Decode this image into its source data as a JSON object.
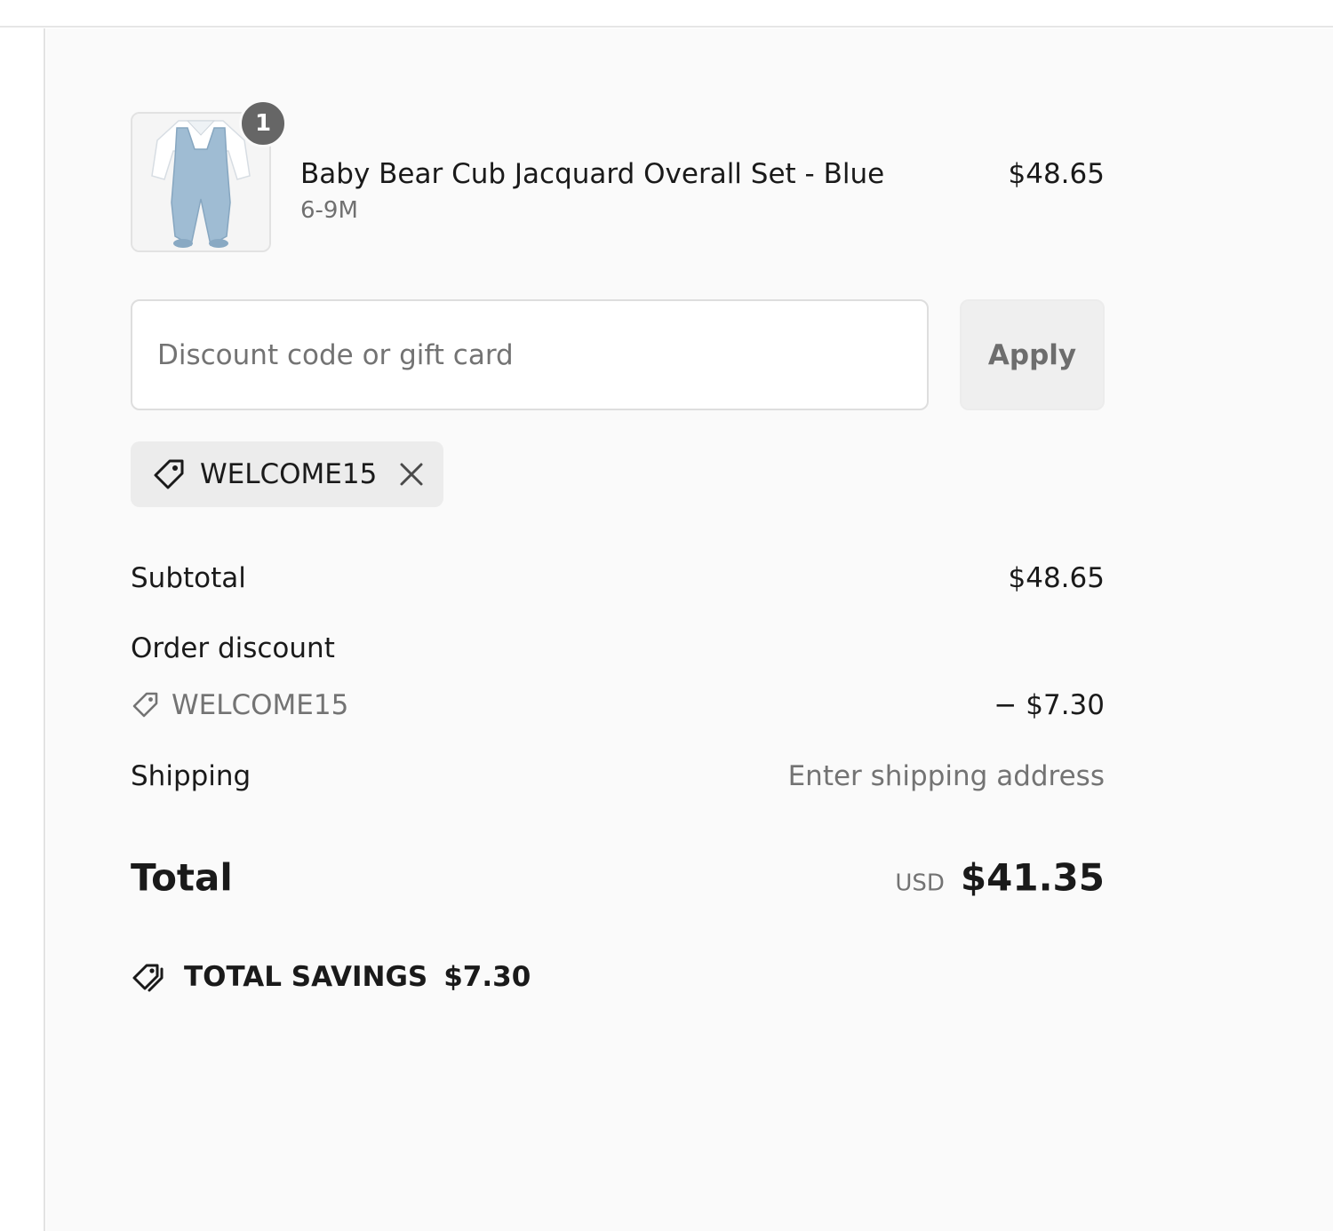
{
  "cart": {
    "items": [
      {
        "name": "Baby Bear Cub Jacquard Overall Set - Blue",
        "variant": "6-9M",
        "price": "$48.65",
        "quantity": "1",
        "image_icon": "overall-set-image"
      }
    ]
  },
  "discount": {
    "placeholder": "Discount code or gift card",
    "value": "",
    "apply_label": "Apply",
    "applied_code": "WELCOME15",
    "tag_icon": "tag-icon",
    "remove_icon": "close-icon"
  },
  "totals": {
    "subtotal_label": "Subtotal",
    "subtotal_value": "$48.65",
    "order_discount_label": "Order discount",
    "discount_code": "WELCOME15",
    "discount_value": "− $7.30",
    "shipping_label": "Shipping",
    "shipping_value": "Enter shipping address",
    "total_label": "Total",
    "currency": "USD",
    "total_value": "$41.35",
    "savings_label": "TOTAL SAVINGS",
    "savings_value": "$7.30",
    "savings_icon": "tags-icon"
  },
  "colors": {
    "summary_background": "#fafafa",
    "badge": "#666666",
    "product_blue": "#9fbcd3",
    "muted_text": "#737373"
  }
}
